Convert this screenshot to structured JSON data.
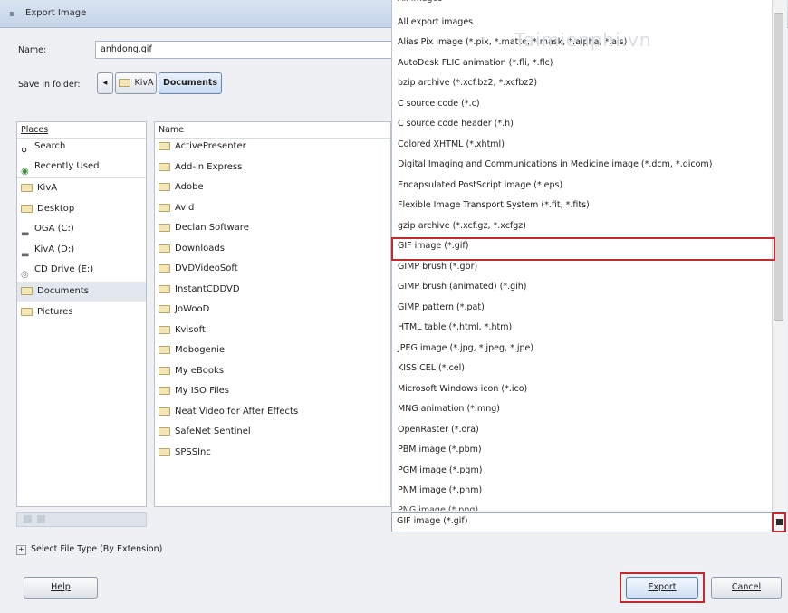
{
  "window": {
    "title": "Export Image"
  },
  "name_row": {
    "label": "Name:",
    "value": "anhdong.gif"
  },
  "save_row": {
    "label": "Save in folder:",
    "crumbs": [
      "KivA",
      "Documents"
    ]
  },
  "places": {
    "header": "Places",
    "items": [
      {
        "label": "Search",
        "icon": "search-icon"
      },
      {
        "label": "Recently Used",
        "icon": "clock-icon"
      },
      {
        "label": "KivA",
        "icon": "folder-icon"
      },
      {
        "label": "Desktop",
        "icon": "folder-icon"
      },
      {
        "label": "OGA (C:)",
        "icon": "drive-icon"
      },
      {
        "label": "KivA (D:)",
        "icon": "drive-icon"
      },
      {
        "label": "CD Drive (E:)",
        "icon": "cd-icon"
      },
      {
        "label": "Documents",
        "icon": "folder-icon"
      },
      {
        "label": "Pictures",
        "icon": "folder-icon"
      }
    ]
  },
  "files": {
    "header": "Name",
    "items": [
      "ActivePresenter",
      "Add-in Express",
      "Adobe",
      "Avid",
      "Declan Software",
      "Downloads",
      "DVDVideoSoft",
      "InstantCDDVD",
      "JoWooD",
      "Kvisoft",
      "Mobogenie",
      "My eBooks",
      "My ISO Files",
      "Neat Video for After Effects",
      "SafeNet Sentinel",
      "SPSSInc"
    ]
  },
  "filetypes": {
    "items": [
      "All export images",
      "Alias Pix image (*.pix, *.matte, *.mask, *.alpha, *.als)",
      "AutoDesk FLIC animation (*.fli, *.flc)",
      "bzip archive (*.xcf.bz2, *.xcfbz2)",
      "C source code (*.c)",
      "C source code header (*.h)",
      "Colored XHTML (*.xhtml)",
      "Digital Imaging and Communications in Medicine image (*.dcm, *.dicom)",
      "Encapsulated PostScript image (*.eps)",
      "Flexible Image Transport System (*.fit, *.fits)",
      "gzip archive (*.xcf.gz, *.xcfgz)",
      "GIF image (*.gif)",
      "GIMP brush (*.gbr)",
      "GIMP brush (animated) (*.gih)",
      "GIMP pattern (*.pat)",
      "HTML table (*.html, *.htm)",
      "JPEG image (*.jpg, *.jpeg, *.jpe)",
      "KISS CEL (*.cel)",
      "Microsoft Windows icon (*.ico)",
      "MNG animation (*.mng)",
      "OpenRaster (*.ora)",
      "PBM image (*.pbm)",
      "PGM image (*.pgm)",
      "PNM image (*.pnm)"
    ],
    "selected": "GIF image (*.gif)"
  },
  "select_type_label": "Select File Type (By Extension)",
  "buttons": {
    "help": "Help",
    "export": "Export",
    "cancel": "Cancel"
  },
  "watermark": "Taimienphi.vn",
  "colors": {
    "highlight": "#c32a2f",
    "selected_place": "#e3e8ef"
  }
}
